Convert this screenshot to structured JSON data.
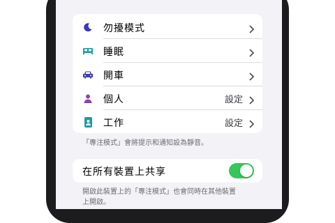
{
  "focus_modes": [
    {
      "label": "勿擾模式",
      "value": "",
      "icon": "moon-icon",
      "icon_color": "#5e5ce6"
    },
    {
      "label": "睡眠",
      "value": "",
      "icon": "bed-icon",
      "icon_color": "#1a9e9e"
    },
    {
      "label": "開車",
      "value": "",
      "icon": "car-icon",
      "icon_color": "#3a3aa8"
    },
    {
      "label": "個人",
      "value": "設定",
      "icon": "person-icon",
      "icon_color": "#8e44ad"
    },
    {
      "label": "工作",
      "value": "設定",
      "icon": "id-badge-icon",
      "icon_color": "#1a9e9e"
    }
  ],
  "focus_footnote": "「專注模式」會將提示和通知設為靜音。",
  "share": {
    "label": "在所有裝置上共享",
    "enabled": true,
    "footnote_line1": "開啟此裝置上的「專注模式」也會同時在其他裝置",
    "footnote_line2": "上開啟。"
  },
  "colors": {
    "toggle_on": "#34c759",
    "background": "#f2f2f7"
  }
}
